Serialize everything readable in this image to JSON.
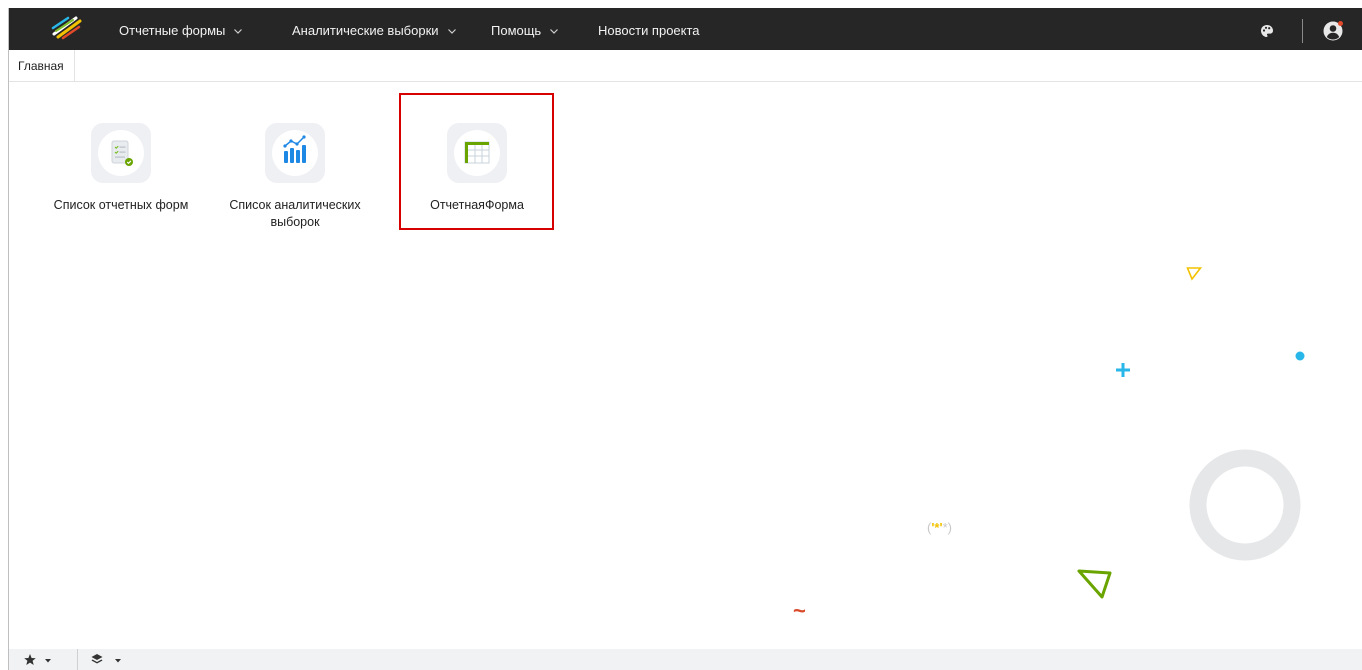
{
  "navbar": {
    "menu": [
      {
        "label": "Отчетные формы",
        "has_dropdown": true
      },
      {
        "label": "Аналитические выборки",
        "has_dropdown": true
      },
      {
        "label": "Помощь",
        "has_dropdown": true
      },
      {
        "label": "Новости проекта",
        "has_dropdown": false
      }
    ],
    "icons": [
      "logo-icon",
      "palette-icon",
      "user-icon"
    ],
    "background": "#262626"
  },
  "tabs": [
    {
      "label": "Главная",
      "active": true
    }
  ],
  "tiles": [
    {
      "label": "Список отчетных форм",
      "icon": "report-list-icon"
    },
    {
      "label": "Список аналитических выборок",
      "icon": "analytics-chart-icon"
    },
    {
      "label": "ОтчетнаяФорма",
      "icon": "table-form-icon",
      "highlighted": true
    }
  ],
  "decorations": {
    "stars_text_left": "(",
    "stars_text_mark": "'*'",
    "stars_text_right": "*)",
    "tilde": "~"
  },
  "bottombar": {
    "icons": [
      "star-icon",
      "layers-icon"
    ]
  },
  "colors": {
    "highlight": "#d60000",
    "accent_blue": "#1e88e5",
    "accent_green": "#6aa400",
    "cyan": "#29b6e8",
    "yellow": "#f2c200"
  }
}
